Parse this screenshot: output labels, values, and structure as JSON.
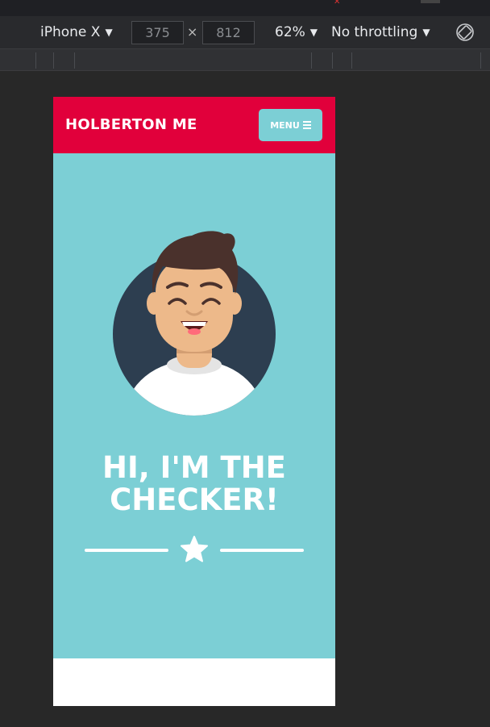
{
  "devtools": {
    "device_name": "iPhone X",
    "width_value": "375",
    "height_value": "812",
    "times_sign": "×",
    "zoom": "62%",
    "throttling": "No throttling"
  },
  "site": {
    "brand": "HOLBERTON ME",
    "menu_label": "MENU",
    "headline_line1": "HI, I'M THE",
    "headline_line2": "CHECKER!"
  },
  "colors": {
    "header_red": "#e1003b",
    "hero_teal": "#7ccfd5",
    "avatar_bg": "#2d3e50"
  },
  "icons": [
    "chevron-down-icon",
    "rotate-icon",
    "hamburger-icon",
    "star-icon"
  ]
}
